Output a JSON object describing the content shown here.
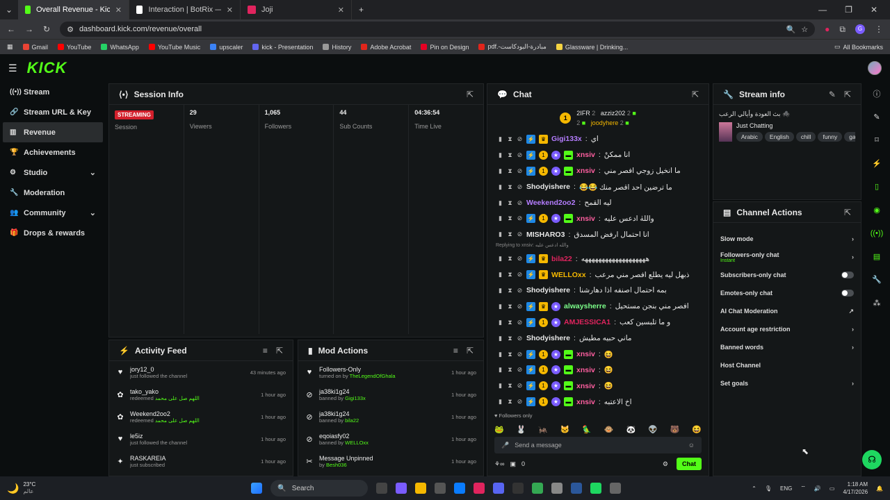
{
  "browser": {
    "tabs": [
      {
        "title": "Overall Revenue - Kick Dashboa",
        "color": "#53fc18",
        "active": true
      },
      {
        "title": "Interaction | BotRix — Clou",
        "color": "#ffffff",
        "active": false
      },
      {
        "title": "Joji",
        "color": "#e0245e",
        "active": false
      }
    ],
    "url": "dashboard.kick.com/revenue/overall",
    "bookmarks": [
      {
        "label": "Gmail",
        "color": "#ea4335"
      },
      {
        "label": "YouTube",
        "color": "#ff0000"
      },
      {
        "label": "WhatsApp",
        "color": "#25d366"
      },
      {
        "label": "YouTube Music",
        "color": "#ff0000"
      },
      {
        "label": "upscaler",
        "color": "#3b82f6"
      },
      {
        "label": "kick - Presentation",
        "color": "#6366f1"
      },
      {
        "label": "History",
        "color": "#999999"
      },
      {
        "label": "Adobe Acrobat",
        "color": "#e1251b"
      },
      {
        "label": "Pin on Design",
        "color": "#e60023"
      },
      {
        "label": "pdf.-مبادرة-البودكاست",
        "color": "#e1251b"
      },
      {
        "label": "Glassware | Drinking...",
        "color": "#f5d442"
      }
    ],
    "all_bookmarks": "All Bookmarks"
  },
  "app": {
    "logo": "KICK"
  },
  "sidebar": {
    "items": [
      {
        "label": "Stream",
        "icon": "broadcast-icon",
        "active": false
      },
      {
        "label": "Stream URL & Key",
        "icon": "link-icon",
        "active": false
      },
      {
        "label": "Revenue",
        "icon": "bar-chart-icon",
        "active": true
      },
      {
        "label": "Achievements",
        "icon": "trophy-icon",
        "active": false
      },
      {
        "label": "Studio",
        "icon": "camera-icon",
        "active": false,
        "expandable": true
      },
      {
        "label": "Moderation",
        "icon": "wrench-icon",
        "active": false
      },
      {
        "label": "Community",
        "icon": "group-icon",
        "active": false,
        "expandable": true
      },
      {
        "label": "Drops & rewards",
        "icon": "gift-icon",
        "active": false
      }
    ]
  },
  "session": {
    "title": "Session Info",
    "live_badge": "STREAMING",
    "columns": [
      {
        "value": "",
        "label": "Session"
      },
      {
        "value": "29",
        "label": "Viewers"
      },
      {
        "value": "1,065",
        "label": "Followers"
      },
      {
        "value": "44",
        "label": "Sub Counts"
      },
      {
        "value": "04:36:54",
        "label": "Time Live"
      }
    ]
  },
  "activity": {
    "title": "Activity Feed",
    "items": [
      {
        "icon": "heart-icon",
        "name": "jory12_0",
        "sub": "just followed the channel",
        "highlight": "",
        "time": "43 minutes ago"
      },
      {
        "icon": "reward-icon",
        "name": "tako_yako",
        "sub": "redeemed",
        "highlight": "اللهم صل على محمد",
        "time": "1 hour ago"
      },
      {
        "icon": "reward-icon",
        "name": "Weekend2oo2",
        "sub": "redeemed",
        "highlight": "اللهم صل على محمد",
        "time": "1 hour ago"
      },
      {
        "icon": "heart-icon",
        "name": "le5iz",
        "sub": "just followed the channel",
        "highlight": "",
        "time": "1 hour ago"
      },
      {
        "icon": "star-icon",
        "name": "RASKAREIA",
        "sub": "just subscribed",
        "highlight": "",
        "time": "1 hour ago"
      }
    ]
  },
  "mod": {
    "title": "Mod Actions",
    "items": [
      {
        "icon": "heart-icon",
        "name": "Followers-Only",
        "sub": "turned on by",
        "highlight": "TheLegendOfGhala",
        "time": "1 hour ago"
      },
      {
        "icon": "ban-icon",
        "name": "ja38ki1g24",
        "sub": "banned by",
        "highlight": "Gigi133x",
        "time": "1 hour ago"
      },
      {
        "icon": "ban-icon",
        "name": "ja38ki1g24",
        "sub": "banned by",
        "highlight": "bila22",
        "time": "1 hour ago"
      },
      {
        "icon": "ban-icon",
        "name": "eqoiasfy02",
        "sub": "banned by",
        "highlight": "WELLOxx",
        "time": "1 hour ago"
      },
      {
        "icon": "unpin-icon",
        "name": "Message Unpinned",
        "sub": "by",
        "highlight": "Besh036",
        "time": "1 hour ago"
      }
    ]
  },
  "chat": {
    "title": "Chat",
    "top": {
      "coin": "1",
      "u1": "2IFR",
      "c1": "2",
      "u2": "azziz202",
      "c2": "2",
      "u3": "joodyhere",
      "c3": "2"
    },
    "messages": [
      {
        "user": "Gigi133x",
        "color": "#b57dff",
        "badges": [
          "vip",
          "crown"
        ],
        "text": "اي"
      },
      {
        "user": "xnsiv",
        "color": "#ff5fa0",
        "badges": [
          "vip",
          "sub",
          "og",
          "green"
        ],
        "text": "انا ممكنْ"
      },
      {
        "user": "xnsiv",
        "color": "#ff5fa0",
        "badges": [
          "vip",
          "sub",
          "og",
          "green"
        ],
        "text": "ما انخيل زوجي افصر مني"
      },
      {
        "user": "Shodyishere",
        "color": "#e8e8e8",
        "badges": [],
        "text": "ما ترضين احد اقصر منك 😂😂"
      },
      {
        "user": "Weekend2oo2",
        "color": "#b57dff",
        "badges": [],
        "text": "ليه القمح"
      },
      {
        "user": "xnsiv",
        "color": "#ff5fa0",
        "badges": [
          "vip",
          "sub",
          "og",
          "green"
        ],
        "text": "واللهٰ ادعس عليه"
      },
      {
        "user": "MISHARO3",
        "color": "#e8e8e8",
        "badges": [],
        "text": "انا احتمال ارفض المسدق"
      },
      {
        "user": "bila22",
        "color": "#e0245e",
        "badges": [
          "vip",
          "crown"
        ],
        "text": "هههههههههههههههههههه",
        "reply": "Replying to xnsiv: والله ادعس عليه"
      },
      {
        "user": "WELLOxx",
        "color": "#f5b800",
        "badges": [
          "vip",
          "crown"
        ],
        "text": "ذبهل ليه يطلع افصر مني مرعب"
      },
      {
        "user": "Shodyishere",
        "color": "#e8e8e8",
        "badges": [],
        "text": "بمه احتمال اصنفه اذا دهارشنا"
      },
      {
        "user": "alwaysherre",
        "color": "#7cff8a",
        "badges": [
          "vip",
          "crown",
          "og"
        ],
        "text": "افصر مني بنجن مستحيل"
      },
      {
        "user": "AMJESSICA1",
        "color": "#e0245e",
        "badges": [
          "vip",
          "sub",
          "og"
        ],
        "text": "و ما تلبسين كعب"
      },
      {
        "user": "Shodyishere",
        "color": "#e8e8e8",
        "badges": [],
        "text": "ماني حبيه مطيش"
      },
      {
        "user": "xnsiv",
        "color": "#ff5fa0",
        "badges": [
          "vip",
          "sub",
          "og",
          "green"
        ],
        "text": "😆"
      },
      {
        "user": "xnsiv",
        "color": "#ff5fa0",
        "badges": [
          "vip",
          "sub",
          "og",
          "green"
        ],
        "text": "😆"
      },
      {
        "user": "xnsiv",
        "color": "#ff5fa0",
        "badges": [
          "vip",
          "sub",
          "og",
          "green"
        ],
        "text": "😆"
      },
      {
        "user": "xnsiv",
        "color": "#ff5fa0",
        "badges": [
          "vip",
          "sub",
          "og",
          "green"
        ],
        "text": "اخ الاعتبه"
      }
    ],
    "followers_only": "Followers only",
    "emotes": [
      "🐸",
      "🐰",
      "🦗",
      "🐱",
      "🦜",
      "🐵",
      "🐼",
      "👽",
      "🐻",
      "😆"
    ],
    "placeholder": "Send a message",
    "count": "0",
    "send": "Chat"
  },
  "stream_info": {
    "title": "Stream info",
    "stream_title": "بث العودة وأيالي الرعب 🕷️",
    "category": "Just Chatting",
    "tags": [
      "Arabic",
      "English",
      "chill",
      "funny",
      "ga"
    ]
  },
  "channel_actions": {
    "title": "Channel Actions",
    "rows": [
      {
        "label": "Slow mode",
        "sub": "",
        "control": "chevron"
      },
      {
        "label": "Followers-only chat",
        "sub": "Instant",
        "control": "chevron"
      },
      {
        "label": "Subscribers-only chat",
        "sub": "",
        "control": "toggle"
      },
      {
        "label": "Emotes-only chat",
        "sub": "",
        "control": "toggle"
      },
      {
        "label": "AI Chat Moderation",
        "sub": "",
        "control": "external"
      },
      {
        "label": "Account age restriction",
        "sub": "",
        "control": "chevron"
      },
      {
        "label": "Banned words",
        "sub": "",
        "control": "chevron"
      },
      {
        "label": "Host Channel",
        "sub": "",
        "control": ""
      },
      {
        "label": "Set goals",
        "sub": "",
        "control": "chevron"
      }
    ]
  },
  "taskbar": {
    "weather_temp": "23°C",
    "weather_sub": "عالم",
    "search": "Search",
    "lang": "ENG",
    "time": "1:18 AM",
    "date": "4/17/2026"
  }
}
